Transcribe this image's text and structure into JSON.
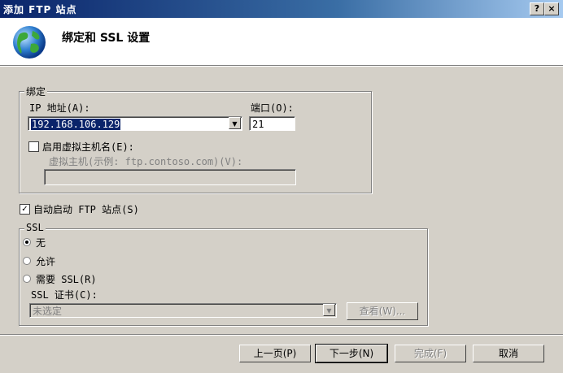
{
  "window": {
    "title": "添加 FTP 站点",
    "help_label": "?",
    "close_label": "×"
  },
  "header": {
    "title": "绑定和 SSL 设置",
    "icon": "globe-icon"
  },
  "binding": {
    "group_label": "绑定",
    "ip_label": "IP 地址(A):",
    "ip_value": "192.168.106.129",
    "port_label": "端口(O):",
    "port_value": "21",
    "virtual_host_checkbox_label": "启用虚拟主机名(E):",
    "virtual_host_checked": false,
    "virtual_host_label": "虚拟主机(示例: ftp.contoso.com)(V):",
    "virtual_host_value": ""
  },
  "autostart": {
    "label": "自动启动 FTP 站点(S)",
    "checked": true
  },
  "ssl": {
    "group_label": "SSL",
    "options": [
      "无",
      "允许",
      "需要 SSL(R)"
    ],
    "selected": "无",
    "cert_label": "SSL 证书(C):",
    "cert_value": "未选定",
    "view_button": "查看(W)..."
  },
  "footer": {
    "prev": "上一页(P)",
    "next": "下一步(N)",
    "finish": "完成(F)",
    "cancel": "取消"
  }
}
